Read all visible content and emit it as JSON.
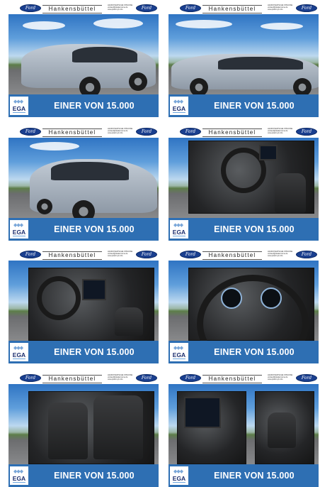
{
  "header": {
    "brand": "Ford",
    "dealer": "Hankensbüttel",
    "address_lines": [
      "HANNOVER'SCHE STRASSE",
      "verkauf@dealername.de",
      "www.platzmyb.info"
    ]
  },
  "banner": {
    "logo_text": "EGA",
    "slogan": "EINER VON 15.000"
  },
  "colors": {
    "banner_blue": "#2e6fb3",
    "ford_blue": "#1a3f8f",
    "ega_navy": "#1d2f6f"
  },
  "gallery": [
    {
      "photo": "car-front-three-quarter"
    },
    {
      "photo": "car-side"
    },
    {
      "photo": "car-rear-three-quarter"
    },
    {
      "photo": "interior-driver-side"
    },
    {
      "photo": "interior-dashboard"
    },
    {
      "photo": "instrument-cluster"
    },
    {
      "photo": "sport-seats"
    },
    {
      "photo": "center-console-and-door"
    }
  ]
}
